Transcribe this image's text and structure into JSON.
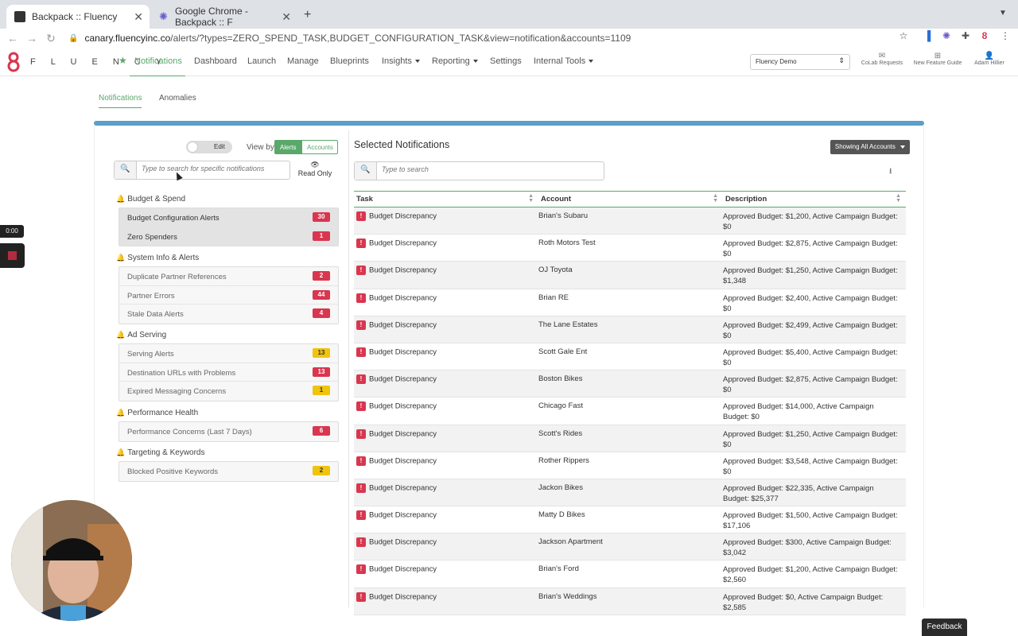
{
  "browser": {
    "tabs": [
      {
        "title": "Backpack :: Fluency",
        "active": true
      },
      {
        "title": "Google Chrome - Backpack :: F",
        "active": false
      }
    ],
    "url_host": "canary.fluencyinc.co",
    "url_path": "/alerts/?types=ZERO_SPEND_TASK,BUDGET_CONFIGURATION_TASK&view=notification&accounts=1109"
  },
  "appnav": {
    "brand": "F L U E N C Y",
    "links": [
      "Notifications",
      "Dashboard",
      "Launch",
      "Manage",
      "Blueprints",
      "Insights",
      "Reporting",
      "Settings",
      "Internal Tools"
    ],
    "account_select": "Fluency Demo",
    "right": [
      {
        "label": "CoLab Requests",
        "icon": "envelope-icon"
      },
      {
        "label": "New Feature Guide",
        "icon": "signpost-icon"
      },
      {
        "label": "Adam Hillier",
        "icon": "user-icon"
      }
    ],
    "accent": "#5aa86a"
  },
  "subtabs": [
    "Notifications",
    "Anomalies"
  ],
  "left": {
    "toggle_label": "Edit",
    "view_by_label": "View by",
    "view_by_options": [
      "Alerts",
      "Accounts"
    ],
    "search_placeholder": "Type to search for specific notifications",
    "read_only_label": "Read Only",
    "groups": [
      {
        "title": "Budget & Spend",
        "items": [
          {
            "label": "Budget Configuration Alerts",
            "count": "30",
            "color": "red",
            "selected": true
          },
          {
            "label": "Zero Spenders",
            "count": "1",
            "color": "red",
            "selected": true
          }
        ]
      },
      {
        "title": "System Info & Alerts",
        "items": [
          {
            "label": "Duplicate Partner References",
            "count": "2",
            "color": "red"
          },
          {
            "label": "Partner Errors",
            "count": "44",
            "color": "red"
          },
          {
            "label": "Stale Data Alerts",
            "count": "4",
            "color": "red"
          }
        ]
      },
      {
        "title": "Ad Serving",
        "items": [
          {
            "label": "Serving Alerts",
            "count": "13",
            "color": "yellow"
          },
          {
            "label": "Destination URLs with Problems",
            "count": "13",
            "color": "red"
          },
          {
            "label": "Expired Messaging Concerns",
            "count": "1",
            "color": "yellow"
          }
        ]
      },
      {
        "title": "Performance Health",
        "items": [
          {
            "label": "Performance Concerns (Last 7 Days)",
            "count": "6",
            "color": "red"
          }
        ]
      },
      {
        "title": "Targeting & Keywords",
        "items": [
          {
            "label": "Blocked Positive Keywords",
            "count": "2",
            "color": "yellow"
          }
        ]
      }
    ]
  },
  "right": {
    "title": "Selected Notifications",
    "showing_button": "Showing All Accounts",
    "search_placeholder": "Type to search",
    "columns": [
      "Task",
      "Account",
      "Description"
    ],
    "rows": [
      {
        "task": "Budget Discrepancy",
        "account": "Brian's Subaru",
        "desc": "Approved Budget: $1,200, Active Campaign Budget: $0"
      },
      {
        "task": "Budget Discrepancy",
        "account": "Roth Motors Test",
        "desc": "Approved Budget: $2,875, Active Campaign Budget: $0"
      },
      {
        "task": "Budget Discrepancy",
        "account": "OJ Toyota",
        "desc": "Approved Budget: $1,250, Active Campaign Budget: $1,348"
      },
      {
        "task": "Budget Discrepancy",
        "account": "Brian RE",
        "desc": "Approved Budget: $2,400, Active Campaign Budget: $0"
      },
      {
        "task": "Budget Discrepancy",
        "account": "The Lane Estates",
        "desc": "Approved Budget: $2,499, Active Campaign Budget: $0"
      },
      {
        "task": "Budget Discrepancy",
        "account": "Scott Gale Ent",
        "desc": "Approved Budget: $5,400, Active Campaign Budget: $0"
      },
      {
        "task": "Budget Discrepancy",
        "account": "Boston Bikes",
        "desc": "Approved Budget: $2,875, Active Campaign Budget: $0"
      },
      {
        "task": "Budget Discrepancy",
        "account": "Chicago Fast",
        "desc": "Approved Budget: $14,000, Active Campaign Budget: $0"
      },
      {
        "task": "Budget Discrepancy",
        "account": "Scott's Rides",
        "desc": "Approved Budget: $1,250, Active Campaign Budget: $0"
      },
      {
        "task": "Budget Discrepancy",
        "account": "Rother Rippers",
        "desc": "Approved Budget: $3,548, Active Campaign Budget: $0"
      },
      {
        "task": "Budget Discrepancy",
        "account": "Jackon Bikes",
        "desc": "Approved Budget: $22,335, Active Campaign Budget: $25,377"
      },
      {
        "task": "Budget Discrepancy",
        "account": "Matty D Bikes",
        "desc": "Approved Budget: $1,500, Active Campaign Budget: $17,106"
      },
      {
        "task": "Budget Discrepancy",
        "account": "Jackson Apartment",
        "desc": "Approved Budget: $300, Active Campaign Budget: $3,042"
      },
      {
        "task": "Budget Discrepancy",
        "account": "Brian's Ford",
        "desc": "Approved Budget: $1,200, Active Campaign Budget: $2,560"
      },
      {
        "task": "Budget Discrepancy",
        "account": "Brian's Weddings",
        "desc": "Approved Budget: $0, Active Campaign Budget: $2,585"
      }
    ]
  },
  "overlay": {
    "timer": "0:00",
    "feedback": "Feedback"
  }
}
